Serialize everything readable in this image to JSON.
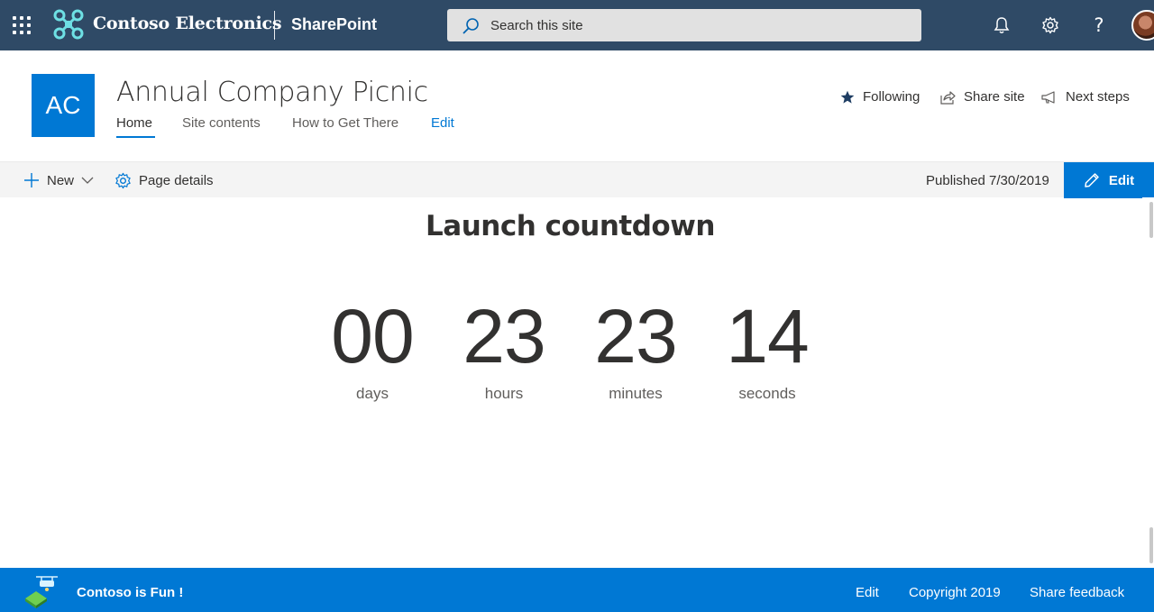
{
  "suite_bar": {
    "org_name": "Contoso Electronics",
    "app_name": "SharePoint",
    "search_placeholder": "Search this site"
  },
  "site": {
    "logo_initials": "AC",
    "title": "Annual Company Picnic",
    "nav": [
      "Home",
      "Site contents",
      "How to Get There",
      "Edit"
    ],
    "actions": {
      "following": "Following",
      "share": "Share site",
      "next_steps": "Next steps"
    }
  },
  "command_bar": {
    "new_label": "New",
    "page_details_label": "Page details",
    "published": "Published 7/30/2019",
    "edit_label": "Edit"
  },
  "countdown": {
    "title": "Launch countdown",
    "units": [
      {
        "value": "00",
        "label": "days"
      },
      {
        "value": "23",
        "label": "hours"
      },
      {
        "value": "23",
        "label": "minutes"
      },
      {
        "value": "14",
        "label": "seconds"
      }
    ]
  },
  "footer": {
    "name": "Contoso is Fun !",
    "links": [
      "Edit",
      "Copyright 2019",
      "Share feedback"
    ]
  },
  "colors": {
    "suite_bar": "#2f4a66",
    "accent": "#0078d4",
    "text": "#323130"
  }
}
